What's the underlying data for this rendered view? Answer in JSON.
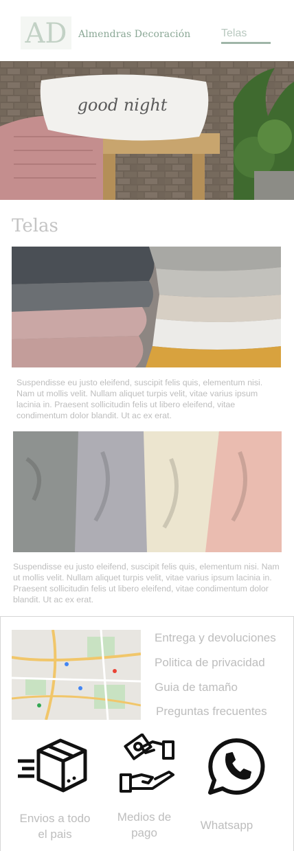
{
  "header": {
    "logo_text": "AD",
    "brand_name": "Almendras Decoración",
    "nav_link": "Telas"
  },
  "hero": {
    "pillow_text": "good night"
  },
  "main": {
    "title": "Telas",
    "paragraph_1": "Suspendisse eu justo eleifend, suscipit felis quis, elementum nisi. Nam ut mollis velit. Nullam aliquet turpis velit, vitae varius ipsum lacinia in. Praesent sollicitudin felis ut libero eleifend, vitae condimentum dolor blandit. Ut ac ex erat.",
    "paragraph_2": "Suspendisse eu justo eleifend, suscipit felis quis, elementum nisi. Nam ut mollis velit. Nullam aliquet turpis velit, vitae varius ipsum lacinia in. Praesent sollicitudin felis ut libero eleifend, vitae condimentum dolor blandit. Ut ac ex erat."
  },
  "footer": {
    "links": [
      "Entrega y devoluciones",
      "Politica de privacidad",
      "Guia de tamaño",
      "Preguntas frecuentes"
    ],
    "features": [
      {
        "label": "Envios a todo el pais",
        "icon": "delivery-box-icon"
      },
      {
        "label": "Medios de pago",
        "icon": "payment-hand-icon"
      },
      {
        "label": "Whatsapp",
        "icon": "whatsapp-icon"
      }
    ]
  },
  "colors": {
    "brand_green": "#8aa795",
    "muted_text": "#bdbdbd"
  }
}
